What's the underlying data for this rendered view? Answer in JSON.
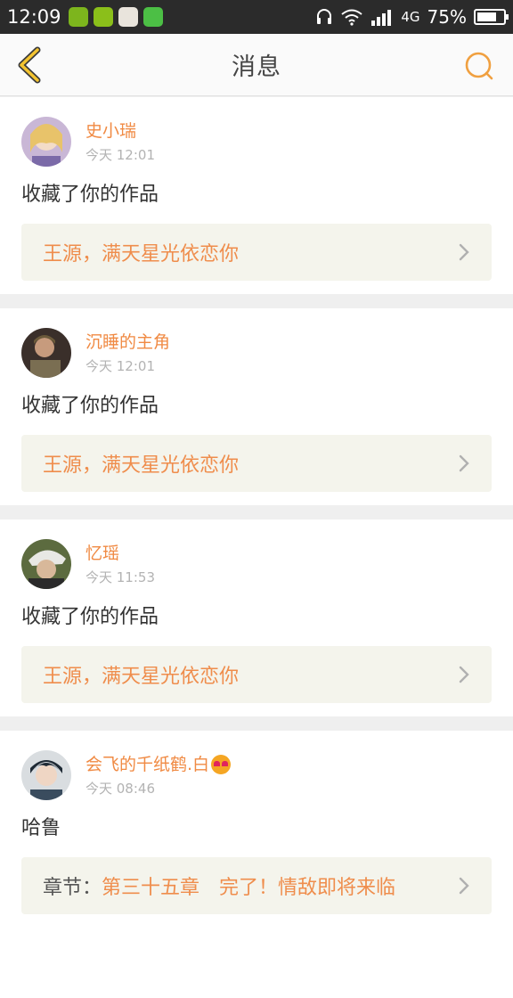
{
  "status_bar": {
    "time": "12:09",
    "network": "4G",
    "battery": "75%",
    "battery_level": 0.75,
    "app_icons": [
      {
        "name": "lemon-app-icon",
        "color": "#7db51d"
      },
      {
        "name": "plus-app-icon",
        "color": "#8bbf1a"
      },
      {
        "name": "gift-app-icon",
        "color": "#e9e4dc"
      },
      {
        "name": "wechat-icon",
        "color": "#4cbf45"
      }
    ]
  },
  "header": {
    "title": "消息",
    "back_icon": "back-chevron-icon",
    "search_icon": "search-icon",
    "accent": "#f0a040"
  },
  "messages": [
    {
      "user": "史小瑞",
      "time": "今天 12:01",
      "text": "收藏了你的作品",
      "link_prefix": "",
      "link_text": "王源，满天星光依恋你"
    },
    {
      "user": "沉睡的主角",
      "time": "今天 12:01",
      "text": "收藏了你的作品",
      "link_prefix": "",
      "link_text": "王源，满天星光依恋你"
    },
    {
      "user": "忆瑶",
      "time": "今天 11:53",
      "text": "收藏了你的作品",
      "link_prefix": "",
      "link_text": "王源，满天星光依恋你"
    },
    {
      "user": "会飞的千纸鹤.白",
      "time": "今天 08:46",
      "text": "哈鲁",
      "link_prefix": "章节：",
      "link_text": "第三十五章　完了！情敌即将来临"
    }
  ]
}
